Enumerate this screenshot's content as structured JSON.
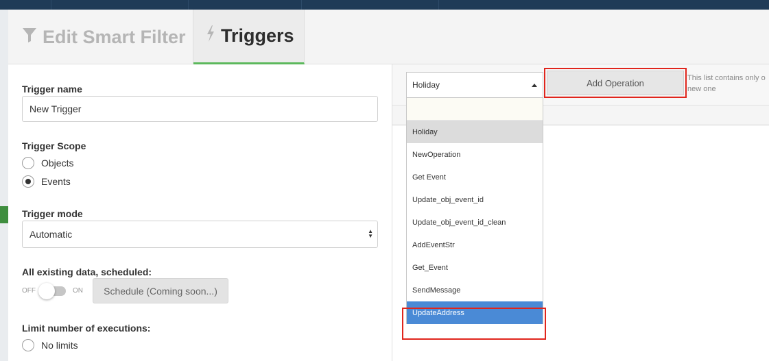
{
  "tabs": {
    "edit_smart_filter": "Edit Smart Filter",
    "triggers": "Triggers"
  },
  "form": {
    "trigger_name_label": "Trigger name",
    "trigger_name_value": "New Trigger",
    "trigger_scope_label": "Trigger Scope",
    "scope_objects": "Objects",
    "scope_events": "Events",
    "trigger_mode_label": "Trigger mode",
    "trigger_mode_value": "Automatic",
    "existing_data_label": "All existing data, scheduled:",
    "toggle_off": "OFF",
    "toggle_on": "ON",
    "schedule_button": "Schedule (Coming soon...)",
    "limit_label": "Limit number of executions:",
    "no_limits": "No limits"
  },
  "operations": {
    "selected": "Holiday",
    "add_button": "Add Operation",
    "hint_line1": "This list contains only o",
    "hint_line2": "new one",
    "options": [
      "Holiday",
      "NewOperation",
      "Get Event",
      "Update_obj_event_id",
      "Update_obj_event_id_clean",
      "AddEventStr",
      "Get_Event",
      "SendMessage",
      "UpdateAddress"
    ],
    "highlighted": "UpdateAddress"
  },
  "colors": {
    "accent_green": "#5cb85c",
    "highlight_blue": "#4a8ad6",
    "annotation_red": "#e0251c"
  },
  "icons": {
    "edit_tab": "filter-icon",
    "triggers_tab": "lightning-icon"
  }
}
